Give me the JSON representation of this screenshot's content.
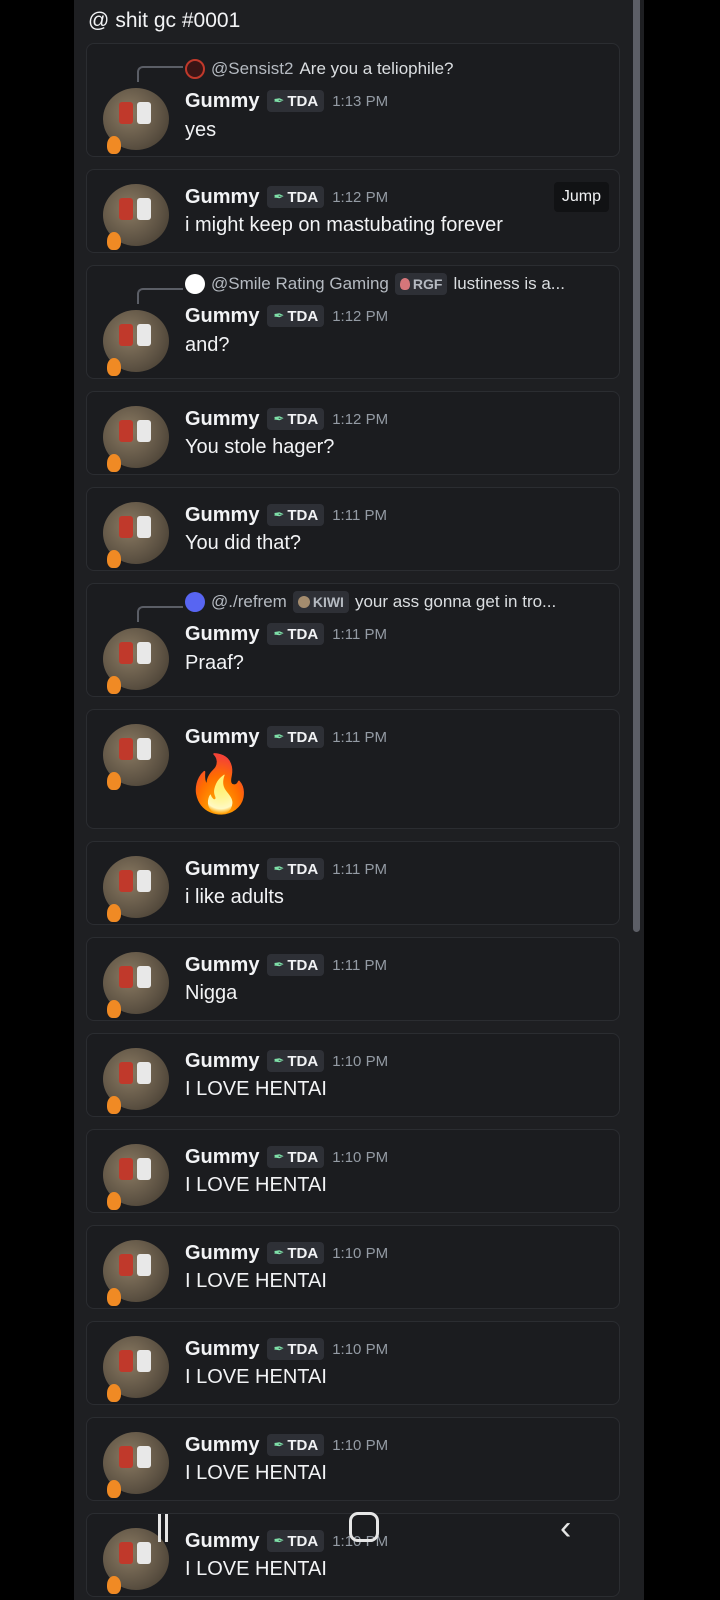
{
  "channel": {
    "prefix": "@",
    "name": "shit gc #0001"
  },
  "jump_label": "Jump",
  "messages": [
    {
      "author": "Gummy",
      "tag": "TDA",
      "time": "1:13 PM",
      "text": "yes",
      "reply": {
        "mention": "@Sensist2",
        "text": "Are you a teliophile?"
      }
    },
    {
      "author": "Gummy",
      "tag": "TDA",
      "time": "1:12 PM",
      "text": "i might keep on mastubating forever"
    },
    {
      "author": "Gummy",
      "tag": "TDA",
      "time": "1:12 PM",
      "text": "and?",
      "reply": {
        "mention": "@Smile Rating Gaming",
        "chip": "RGF",
        "text": "lustiness is a..."
      }
    },
    {
      "author": "Gummy",
      "tag": "TDA",
      "time": "1:12 PM",
      "text": "You stole hager?"
    },
    {
      "author": "Gummy",
      "tag": "TDA",
      "time": "1:11 PM",
      "text": "You did that?"
    },
    {
      "author": "Gummy",
      "tag": "TDA",
      "time": "1:11 PM",
      "text": "Praaf?",
      "reply": {
        "mention": "@./refrem",
        "chip": "KIWI",
        "text": "your ass gonna get in tro..."
      }
    },
    {
      "author": "Gummy",
      "tag": "TDA",
      "time": "1:11 PM",
      "text": "🔥"
    },
    {
      "author": "Gummy",
      "tag": "TDA",
      "time": "1:11 PM",
      "text": "i like adults"
    },
    {
      "author": "Gummy",
      "tag": "TDA",
      "time": "1:11 PM",
      "text": "Nigga"
    },
    {
      "author": "Gummy",
      "tag": "TDA",
      "time": "1:10 PM",
      "text": "I LOVE HENTAI"
    },
    {
      "author": "Gummy",
      "tag": "TDA",
      "time": "1:10 PM",
      "text": "I LOVE HENTAI"
    },
    {
      "author": "Gummy",
      "tag": "TDA",
      "time": "1:10 PM",
      "text": "I LOVE HENTAI"
    },
    {
      "author": "Gummy",
      "tag": "TDA",
      "time": "1:10 PM",
      "text": "I LOVE HENTAI"
    },
    {
      "author": "Gummy",
      "tag": "TDA",
      "time": "1:10 PM",
      "text": "I LOVE HENTAI"
    },
    {
      "author": "Gummy",
      "tag": "TDA",
      "time": "1:10 PM",
      "text": "I LOVE HENTAI"
    }
  ],
  "nav_icons": [
    "recent-apps-icon",
    "home-icon",
    "back-icon"
  ]
}
